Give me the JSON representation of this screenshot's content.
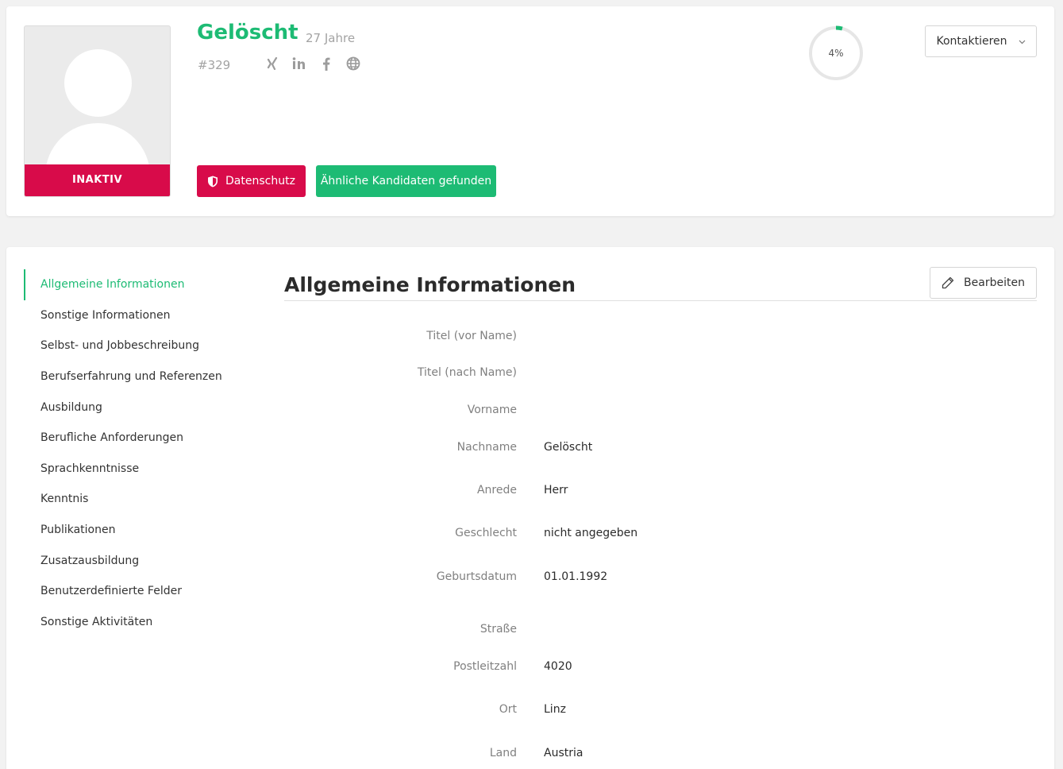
{
  "profile": {
    "name": "Gelöscht",
    "age": "27 Jahre",
    "id": "#329",
    "status": "INAKTIV",
    "privacy_button": "Datenschutz",
    "similar_button": "Ähnliche Kandidaten gefunden",
    "completion": "4%",
    "completion_value": 4,
    "contact_button": "Kontaktieren",
    "socials": [
      "xing-icon",
      "linkedin-icon",
      "facebook-icon",
      "globe-icon"
    ]
  },
  "nav": {
    "items": [
      {
        "label": "Allgemeine Informationen",
        "active": true
      },
      {
        "label": "Sonstige Informationen"
      },
      {
        "label": "Selbst- und Jobbeschreibung"
      },
      {
        "label": "Berufserfahrung und Referenzen"
      },
      {
        "label": "Ausbildung"
      },
      {
        "label": "Berufliche Anforderungen"
      },
      {
        "label": "Sprachkenntnisse"
      },
      {
        "label": "Kenntnis"
      },
      {
        "label": "Publikationen"
      },
      {
        "label": "Zusatzausbildung"
      },
      {
        "label": "Benutzerdefinierte Felder"
      },
      {
        "label": "Sonstige Aktivitäten"
      }
    ]
  },
  "section": {
    "title": "Allgemeine Informationen",
    "edit_button": "Bearbeiten",
    "fields": [
      {
        "label": "Titel (vor Name)",
        "value": ""
      },
      {
        "label": "Titel (nach Name)",
        "value": ""
      },
      {
        "label": "Vorname",
        "value": ""
      },
      {
        "label": "Nachname",
        "value": "Gelöscht"
      },
      {
        "label": "Anrede",
        "value": "Herr"
      },
      {
        "label": "Geschlecht",
        "value": "nicht angegeben"
      },
      {
        "label": "Geburtsdatum",
        "value": "01.01.1992"
      },
      {
        "label": "Straße",
        "value": ""
      },
      {
        "label": "Postleitzahl",
        "value": "4020"
      },
      {
        "label": "Ort",
        "value": "Linz"
      },
      {
        "label": "Land",
        "value": "Austria"
      }
    ]
  },
  "colors": {
    "accent_green": "#1dbb74",
    "accent_red": "#d80b4a"
  }
}
